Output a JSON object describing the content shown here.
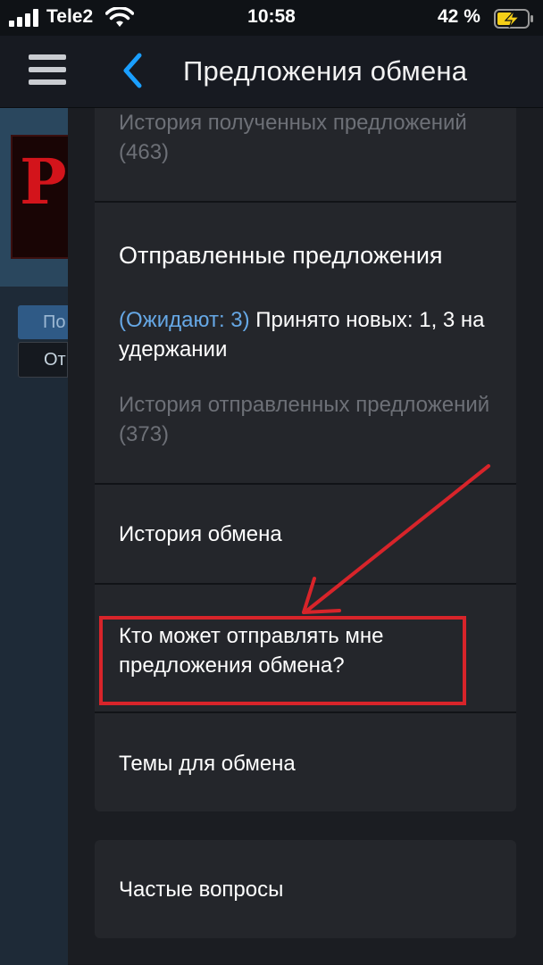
{
  "status_bar": {
    "carrier": "Tele2",
    "time": "10:58",
    "battery_percent": "42 %",
    "icons": [
      "signal-icon",
      "wifi-icon",
      "battery-charging-icon"
    ]
  },
  "header": {
    "title": "Предложения обмена",
    "icons": [
      "menu-icon",
      "back-chevron-icon"
    ]
  },
  "background_page": {
    "tab_1_label": "По",
    "tab_2_label": "От"
  },
  "menu": {
    "received_history": "История полученных предложений (463)",
    "sent_title": "Отправленные предложения",
    "sent_pending": "(Ожидают: 3)",
    "sent_status": "Принято новых: 1, 3 на удержании",
    "sent_history": "История отправленных предложений (373)",
    "trade_history": "История обмена",
    "who_can_send": "Кто может отправлять мне предложения обмена?",
    "trade_topics": "Темы для обмена",
    "faq": "Частые вопросы"
  },
  "annotation": {
    "highlight_color": "#d8242a"
  }
}
